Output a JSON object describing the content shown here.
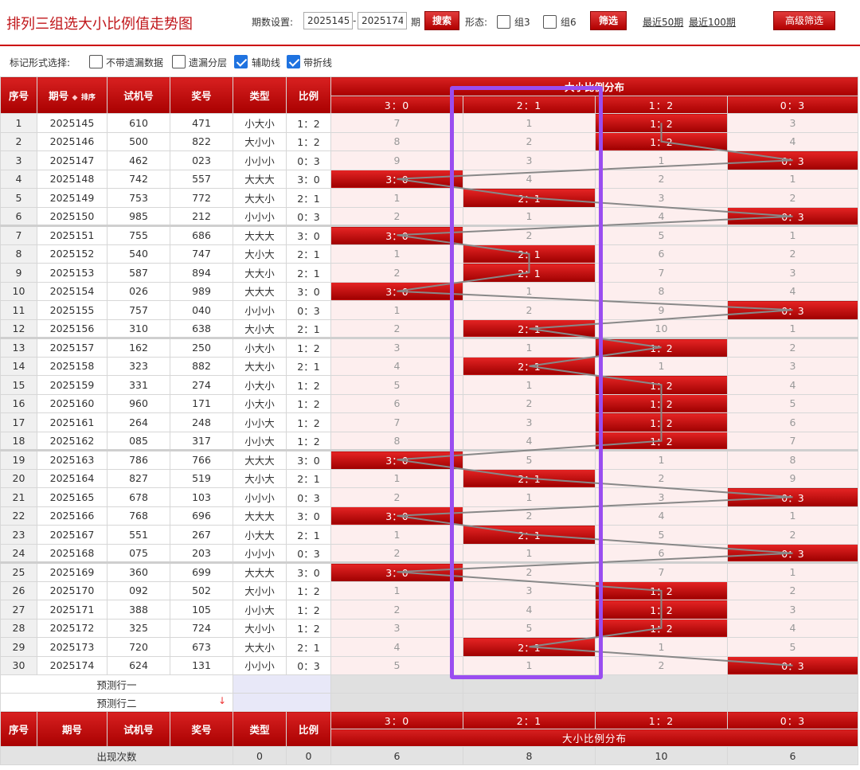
{
  "header": {
    "title": "排列三组选大小比例值走势图",
    "period_label": "期数设置:",
    "period_from": "2025145",
    "period_sep": "-",
    "period_to": "2025174",
    "period_unit": "期",
    "search_label": "搜索",
    "shape_label": "形态:",
    "group3_label": "组3",
    "group6_label": "组6",
    "filter_label": "筛选",
    "recent50_label": "最近50期",
    "recent100_label": "最近100期",
    "advanced_label": "高级筛选"
  },
  "marks": {
    "label": "标记形式选择:",
    "no_omission_label": "不带遗漏数据",
    "omission_layer_label": "遗漏分层",
    "guide_line_label": "辅助线",
    "polyline_label": "带折线",
    "no_omission_checked": false,
    "omission_layer_checked": false,
    "guide_line_checked": true,
    "polyline_checked": true
  },
  "table": {
    "headers": {
      "seq": "序号",
      "period": "期号",
      "sort": "排序",
      "trial": "试机号",
      "prize": "奖号",
      "type": "类型",
      "ratio": "比例",
      "dist_title": "大小比例分布"
    },
    "dist_cols": [
      "3：0",
      "2：1",
      "1：2",
      "0：3"
    ],
    "rows": [
      {
        "seq": "1",
        "period": "2025145",
        "trial": "610",
        "prize": "471",
        "type": "小大小",
        "ratio": "1：2",
        "dist": [
          "7",
          "1",
          "1：2",
          "3"
        ],
        "hit": 2
      },
      {
        "seq": "2",
        "period": "2025146",
        "trial": "500",
        "prize": "822",
        "type": "大小小",
        "ratio": "1：2",
        "dist": [
          "8",
          "2",
          "1：2",
          "4"
        ],
        "hit": 2
      },
      {
        "seq": "3",
        "period": "2025147",
        "trial": "462",
        "prize": "023",
        "type": "小小小",
        "ratio": "0：3",
        "dist": [
          "9",
          "3",
          "1",
          "0：3"
        ],
        "hit": 3
      },
      {
        "seq": "4",
        "period": "2025148",
        "trial": "742",
        "prize": "557",
        "type": "大大大",
        "ratio": "3：0",
        "dist": [
          "3：0",
          "4",
          "2",
          "1"
        ],
        "hit": 0
      },
      {
        "seq": "5",
        "period": "2025149",
        "trial": "753",
        "prize": "772",
        "type": "大大小",
        "ratio": "2：1",
        "dist": [
          "1",
          "2：1",
          "3",
          "2"
        ],
        "hit": 1
      },
      {
        "seq": "6",
        "period": "2025150",
        "trial": "985",
        "prize": "212",
        "type": "小小小",
        "ratio": "0：3",
        "dist": [
          "2",
          "1",
          "4",
          "0：3"
        ],
        "hit": 3
      },
      {
        "seq": "7",
        "period": "2025151",
        "trial": "755",
        "prize": "686",
        "type": "大大大",
        "ratio": "3：0",
        "dist": [
          "3：0",
          "2",
          "5",
          "1"
        ],
        "hit": 0
      },
      {
        "seq": "8",
        "period": "2025152",
        "trial": "540",
        "prize": "747",
        "type": "大小大",
        "ratio": "2：1",
        "dist": [
          "1",
          "2：1",
          "6",
          "2"
        ],
        "hit": 1
      },
      {
        "seq": "9",
        "period": "2025153",
        "trial": "587",
        "prize": "894",
        "type": "大大小",
        "ratio": "2：1",
        "dist": [
          "2",
          "2：1",
          "7",
          "3"
        ],
        "hit": 1
      },
      {
        "seq": "10",
        "period": "2025154",
        "trial": "026",
        "prize": "989",
        "type": "大大大",
        "ratio": "3：0",
        "dist": [
          "3：0",
          "1",
          "8",
          "4"
        ],
        "hit": 0
      },
      {
        "seq": "11",
        "period": "2025155",
        "trial": "757",
        "prize": "040",
        "type": "小小小",
        "ratio": "0：3",
        "dist": [
          "1",
          "2",
          "9",
          "0：3"
        ],
        "hit": 3
      },
      {
        "seq": "12",
        "period": "2025156",
        "trial": "310",
        "prize": "638",
        "type": "大小大",
        "ratio": "2：1",
        "dist": [
          "2",
          "2：1",
          "10",
          "1"
        ],
        "hit": 1
      },
      {
        "seq": "13",
        "period": "2025157",
        "trial": "162",
        "prize": "250",
        "type": "小大小",
        "ratio": "1：2",
        "dist": [
          "3",
          "1",
          "1：2",
          "2"
        ],
        "hit": 2
      },
      {
        "seq": "14",
        "period": "2025158",
        "trial": "323",
        "prize": "882",
        "type": "大大小",
        "ratio": "2：1",
        "dist": [
          "4",
          "2：1",
          "1",
          "3"
        ],
        "hit": 1
      },
      {
        "seq": "15",
        "period": "2025159",
        "trial": "331",
        "prize": "274",
        "type": "小大小",
        "ratio": "1：2",
        "dist": [
          "5",
          "1",
          "1：2",
          "4"
        ],
        "hit": 2
      },
      {
        "seq": "16",
        "period": "2025160",
        "trial": "960",
        "prize": "171",
        "type": "小大小",
        "ratio": "1：2",
        "dist": [
          "6",
          "2",
          "1：2",
          "5"
        ],
        "hit": 2
      },
      {
        "seq": "17",
        "period": "2025161",
        "trial": "264",
        "prize": "248",
        "type": "小小大",
        "ratio": "1：2",
        "dist": [
          "7",
          "3",
          "1：2",
          "6"
        ],
        "hit": 2
      },
      {
        "seq": "18",
        "period": "2025162",
        "trial": "085",
        "prize": "317",
        "type": "小小大",
        "ratio": "1：2",
        "dist": [
          "8",
          "4",
          "1：2",
          "7"
        ],
        "hit": 2
      },
      {
        "seq": "19",
        "period": "2025163",
        "trial": "786",
        "prize": "766",
        "type": "大大大",
        "ratio": "3：0",
        "dist": [
          "3：0",
          "5",
          "1",
          "8"
        ],
        "hit": 0
      },
      {
        "seq": "20",
        "period": "2025164",
        "trial": "827",
        "prize": "519",
        "type": "大小大",
        "ratio": "2：1",
        "dist": [
          "1",
          "2：1",
          "2",
          "9"
        ],
        "hit": 1
      },
      {
        "seq": "21",
        "period": "2025165",
        "trial": "678",
        "prize": "103",
        "type": "小小小",
        "ratio": "0：3",
        "dist": [
          "2",
          "1",
          "3",
          "0：3"
        ],
        "hit": 3
      },
      {
        "seq": "22",
        "period": "2025166",
        "trial": "768",
        "prize": "696",
        "type": "大大大",
        "ratio": "3：0",
        "dist": [
          "3：0",
          "2",
          "4",
          "1"
        ],
        "hit": 0
      },
      {
        "seq": "23",
        "period": "2025167",
        "trial": "551",
        "prize": "267",
        "type": "小大大",
        "ratio": "2：1",
        "dist": [
          "1",
          "2：1",
          "5",
          "2"
        ],
        "hit": 1
      },
      {
        "seq": "24",
        "period": "2025168",
        "trial": "075",
        "prize": "203",
        "type": "小小小",
        "ratio": "0：3",
        "dist": [
          "2",
          "1",
          "6",
          "0：3"
        ],
        "hit": 3
      },
      {
        "seq": "25",
        "period": "2025169",
        "trial": "360",
        "prize": "699",
        "type": "大大大",
        "ratio": "3：0",
        "dist": [
          "3：0",
          "2",
          "7",
          "1"
        ],
        "hit": 0
      },
      {
        "seq": "26",
        "period": "2025170",
        "trial": "092",
        "prize": "502",
        "type": "大小小",
        "ratio": "1：2",
        "dist": [
          "1",
          "3",
          "1：2",
          "2"
        ],
        "hit": 2
      },
      {
        "seq": "27",
        "period": "2025171",
        "trial": "388",
        "prize": "105",
        "type": "小小大",
        "ratio": "1：2",
        "dist": [
          "2",
          "4",
          "1：2",
          "3"
        ],
        "hit": 2
      },
      {
        "seq": "28",
        "period": "2025172",
        "trial": "325",
        "prize": "724",
        "type": "大小小",
        "ratio": "1：2",
        "dist": [
          "3",
          "5",
          "1：2",
          "4"
        ],
        "hit": 2
      },
      {
        "seq": "29",
        "period": "2025173",
        "trial": "720",
        "prize": "673",
        "type": "大大小",
        "ratio": "2：1",
        "dist": [
          "4",
          "2：1",
          "1",
          "5"
        ],
        "hit": 1
      },
      {
        "seq": "30",
        "period": "2025174",
        "trial": "624",
        "prize": "131",
        "type": "小小小",
        "ratio": "0：3",
        "dist": [
          "5",
          "1",
          "2",
          "0：3"
        ],
        "hit": 3
      }
    ],
    "predict1_label": "预测行一",
    "predict2_label": "预测行二",
    "footer_headers": {
      "seq": "序号",
      "period": "期号",
      "trial": "试机号",
      "prize": "奖号",
      "type": "类型",
      "ratio": "比例",
      "dist_title": "大小比例分布"
    },
    "stats": [
      {
        "label": "出现次数",
        "type": "0",
        "ratio": "0",
        "dist": [
          "6",
          "8",
          "10",
          "6"
        ]
      }
    ]
  },
  "colors": {
    "accent_red": "#c0161a",
    "highlight_purple": "#9a4df0",
    "checkbox_blue": "#1f73e0"
  }
}
